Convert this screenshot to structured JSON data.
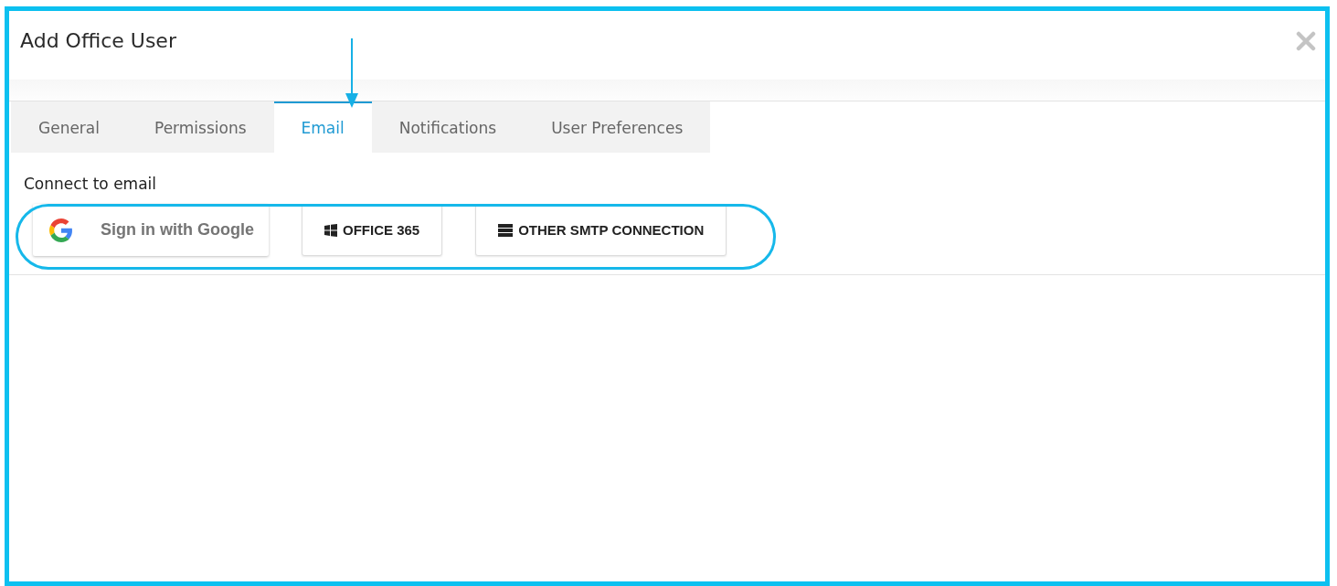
{
  "dialog": {
    "title": "Add Office User"
  },
  "tabs": [
    {
      "label": "General",
      "selected": false
    },
    {
      "label": "Permissions",
      "selected": false
    },
    {
      "label": "Email",
      "selected": true
    },
    {
      "label": "Notifications",
      "selected": false
    },
    {
      "label": "User Preferences",
      "selected": false
    }
  ],
  "email": {
    "label": "Connect to email",
    "buttons": [
      {
        "kind": "google",
        "label": "Sign in with Google"
      },
      {
        "kind": "windows",
        "label": "OFFICE 365"
      },
      {
        "kind": "server",
        "label": "OTHER SMTP CONNECTION"
      }
    ]
  }
}
